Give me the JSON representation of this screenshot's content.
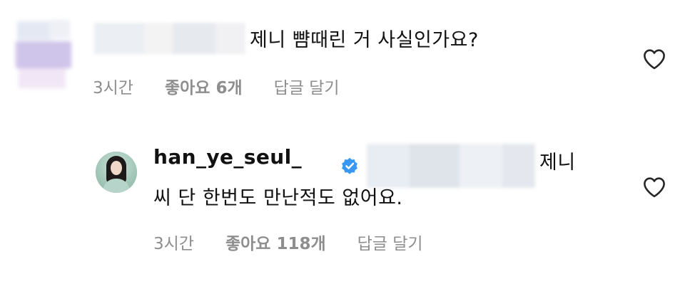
{
  "comments": [
    {
      "text": "제니 뺨때린 거 사실인가요?",
      "time": "3시간",
      "likes": "좋아요 6개",
      "reply": "답글 달기"
    },
    {
      "username": "han_ye_seul_",
      "text_line1": "제니",
      "text_line2": "씨 단 한번도 만난적도 없어요.",
      "time": "3시간",
      "likes": "좋아요 118개",
      "reply": "답글 달기"
    }
  ],
  "icons": {
    "like": "heart-outline-icon",
    "verified": "verified-badge-icon"
  },
  "colors": {
    "text": "#111111",
    "meta": "#8e8e8e",
    "verified": "#3897f0"
  }
}
